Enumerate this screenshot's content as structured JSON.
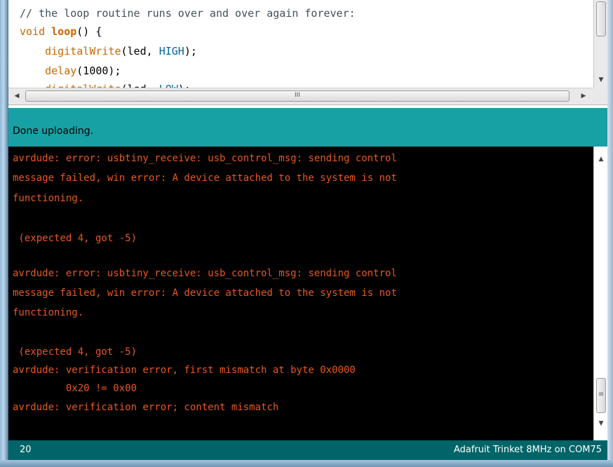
{
  "editor": {
    "lines": [
      [
        {
          "t": "// the loop routine runs over and over again forever:",
          "c": "comment"
        }
      ],
      [
        {
          "t": "void",
          "c": "type"
        },
        {
          "t": " ",
          "c": "plain"
        },
        {
          "t": "loop",
          "c": "fn"
        },
        {
          "t": "() {",
          "c": "plain"
        }
      ],
      [
        {
          "t": "    ",
          "c": "plain"
        },
        {
          "t": "digitalWrite",
          "c": "builtin"
        },
        {
          "t": "(led, ",
          "c": "plain"
        },
        {
          "t": "HIGH",
          "c": "const"
        },
        {
          "t": ");",
          "c": "plain"
        }
      ],
      [
        {
          "t": "    ",
          "c": "plain"
        },
        {
          "t": "delay",
          "c": "builtin"
        },
        {
          "t": "(1000);",
          "c": "plain"
        }
      ],
      [
        {
          "t": "    ",
          "c": "plain"
        },
        {
          "t": "digitalWrite",
          "c": "builtin"
        },
        {
          "t": "(led, ",
          "c": "plain"
        },
        {
          "t": "LOW",
          "c": "const"
        },
        {
          "t": ");",
          "c": "plain"
        }
      ]
    ],
    "hscroll_grip": "III"
  },
  "status": {
    "message": "Done uploading."
  },
  "console": {
    "lines": [
      "avrdude: error: usbtiny_receive: usb_control_msg: sending control",
      "message failed, win error: A device attached to the system is not",
      "functioning.",
      "",
      " (expected 4, got -5)",
      "",
      "avrdude: error: usbtiny_receive: usb_control_msg: sending control",
      "message failed, win error: A device attached to the system is not",
      "functioning.",
      "",
      " (expected 4, got -5)",
      "avrdude: verification error, first mismatch at byte 0x0000",
      "         0x20 != 0x00",
      "avrdude: verification error; content mismatch"
    ],
    "scroll_grip": "≡"
  },
  "footer": {
    "line_number": "20",
    "board": "Adafruit Trinket 8MHz on COM75"
  },
  "colors": {
    "status_bg": "#17a1a5",
    "footer_bg": "#006468",
    "console_text": "#e8581e",
    "console_bg": "#000000"
  }
}
